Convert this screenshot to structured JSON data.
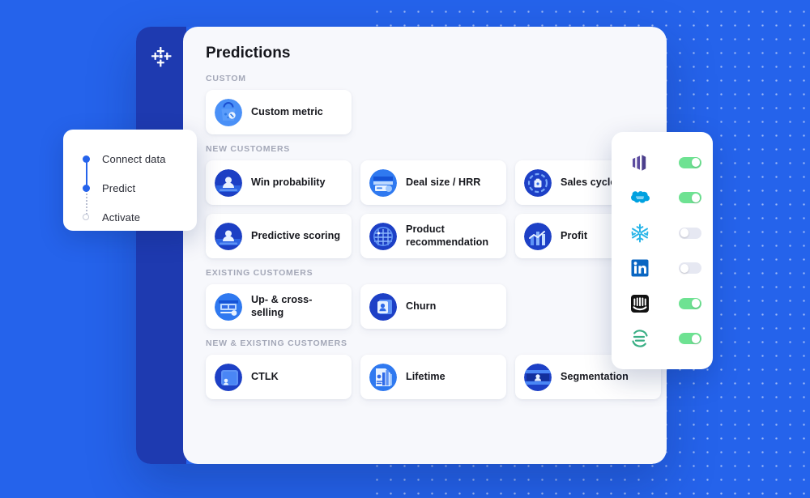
{
  "theme": {
    "background_blue": "#2563EB",
    "sidebar_blue": "#1E3AB0",
    "panel_bg": "#F7F8FC",
    "card_bg": "#FFFFFF",
    "toggle_on": "#6EE292",
    "toggle_off": "#E6E8F2",
    "accent": "#2563EB"
  },
  "app": {
    "logo_name": "tableau-style-cross-logo",
    "title": "Predictions"
  },
  "stepper": {
    "steps": [
      {
        "label": "Connect data",
        "state": "active"
      },
      {
        "label": "Predict",
        "state": "active"
      },
      {
        "label": "Activate",
        "state": "inactive"
      }
    ]
  },
  "sections": [
    {
      "label": "CUSTOM",
      "cards": [
        {
          "label": "Custom metric",
          "icon": "custom-metric-icon"
        }
      ]
    },
    {
      "label": "NEW CUSTOMERS",
      "cards": [
        {
          "label": "Win probability",
          "icon": "win-probability-icon"
        },
        {
          "label": "Deal size / HRR",
          "icon": "deal-size-icon"
        },
        {
          "label": "Sales cycle",
          "icon": "sales-cycle-icon"
        },
        {
          "label": "Predictive scoring",
          "icon": "predictive-scoring-icon"
        },
        {
          "label": "Product recommendation",
          "icon": "product-recommendation-icon"
        },
        {
          "label": "Profit",
          "icon": "profit-icon"
        }
      ]
    },
    {
      "label": "EXISTING CUSTOMERS",
      "cards": [
        {
          "label": "Up- & cross-selling",
          "icon": "up-cross-selling-icon"
        },
        {
          "label": "Churn",
          "icon": "churn-icon"
        }
      ]
    },
    {
      "label": "NEW & EXISTING CUSTOMERS",
      "cards": [
        {
          "label": "CTLK",
          "icon": "ctlk-icon"
        },
        {
          "label": "Lifetime",
          "icon": "lifetime-icon"
        },
        {
          "label": "Segmentation",
          "icon": "segmentation-icon"
        }
      ]
    }
  ],
  "integrations": [
    {
      "name": "Marketo",
      "icon": "marketo-logo",
      "enabled": true
    },
    {
      "name": "Salesforce",
      "icon": "salesforce-logo",
      "enabled": true
    },
    {
      "name": "Snowflake",
      "icon": "snowflake-logo",
      "enabled": false
    },
    {
      "name": "LinkedIn",
      "icon": "linkedin-logo",
      "enabled": false
    },
    {
      "name": "Intercom",
      "icon": "intercom-logo",
      "enabled": true
    },
    {
      "name": "Segment",
      "icon": "segment-logo",
      "enabled": true
    }
  ]
}
